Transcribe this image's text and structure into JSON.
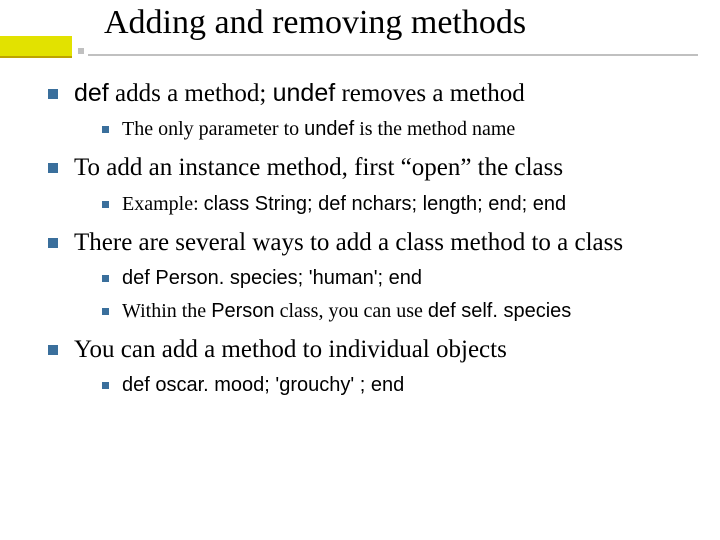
{
  "title": "Adding and removing methods",
  "bullets": [
    {
      "runs": [
        {
          "text": "def",
          "style": "mono"
        },
        {
          "text": " adds a method; ",
          "style": "t-serif"
        },
        {
          "text": "undef",
          "style": "mono"
        },
        {
          "text": " removes a method",
          "style": "t-serif"
        }
      ],
      "children": [
        {
          "runs": [
            {
              "text": "The only parameter to ",
              "style": "t-serif"
            },
            {
              "text": "undef",
              "style": "mono"
            },
            {
              "text": " is the method name",
              "style": "t-serif"
            }
          ]
        }
      ]
    },
    {
      "runs": [
        {
          "text": "To add an instance method, first “open” the class",
          "style": "t-serif"
        }
      ],
      "children": [
        {
          "runs": [
            {
              "text": "Example: ",
              "style": "t-serif"
            },
            {
              "text": "class String; def nchars; length; end; end",
              "style": "mono"
            }
          ]
        }
      ]
    },
    {
      "runs": [
        {
          "text": "There are several ways to add a class method to a class",
          "style": "t-serif"
        }
      ],
      "children": [
        {
          "runs": [
            {
              "text": "def Person. species; 'human'; end",
              "style": "mono"
            }
          ]
        },
        {
          "runs": [
            {
              "text": "Within the ",
              "style": "t-serif"
            },
            {
              "text": "Person",
              "style": "mono"
            },
            {
              "text": " class, you can use ",
              "style": "t-serif"
            },
            {
              "text": "def self. species",
              "style": "mono"
            }
          ]
        }
      ]
    },
    {
      "runs": [
        {
          "text": "You can add a method to individual objects",
          "style": "t-serif"
        }
      ],
      "children": [
        {
          "runs": [
            {
              "text": "def oscar. mood; 'grouchy' ; end",
              "style": "mono"
            }
          ]
        }
      ]
    }
  ]
}
